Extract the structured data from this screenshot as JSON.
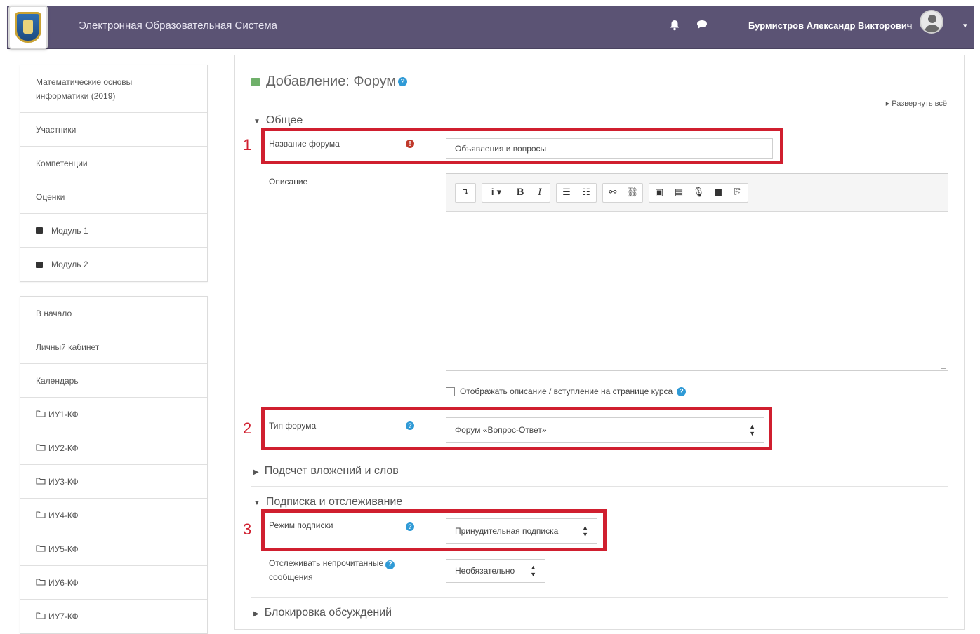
{
  "header": {
    "site_title": "Электронная Образовательная Система",
    "user_name": "Бурмистров Александр Викторович",
    "bell_icon": "bell-icon",
    "chat_icon": "chat-icon",
    "caret": "▾"
  },
  "sidebar": {
    "course_block": [
      {
        "label": "Математические основы информатики (2019)",
        "icon": ""
      },
      {
        "label": "Участники",
        "icon": ""
      },
      {
        "label": "Компетенции",
        "icon": ""
      },
      {
        "label": "Оценки",
        "icon": ""
      },
      {
        "label": "Модуль 1",
        "icon": "module-icon"
      },
      {
        "label": "Модуль 2",
        "icon": "module-icon"
      }
    ],
    "nav_block": [
      {
        "label": "В начало"
      },
      {
        "label": "Личный кабинет"
      },
      {
        "label": "Календарь"
      },
      {
        "label": "ИУ1-КФ"
      },
      {
        "label": "ИУ2-КФ"
      },
      {
        "label": "ИУ3-КФ"
      },
      {
        "label": "ИУ4-КФ"
      },
      {
        "label": "ИУ5-КФ"
      },
      {
        "label": "ИУ6-КФ"
      },
      {
        "label": "ИУ7-КФ"
      }
    ]
  },
  "main": {
    "heading": "Добавление: Форум",
    "expand_all": "Развернуть всё",
    "section_general": "Общее",
    "forum_name_label": "Название форума",
    "forum_name_value": "Объявления и вопросы",
    "description_label": "Описание",
    "show_description_label": "Отображать описание / вступление на странице курса",
    "forum_type_label": "Тип форума",
    "forum_type_value": "Форум «Вопрос-Ответ»",
    "section_attachments": "Подсчет вложений и слов",
    "section_subscription": "Подписка и отслеживание",
    "subscription_mode_label": "Режим подписки",
    "subscription_mode_value": "Принудительная подписка",
    "track_unread_label_1": "Отслеживать непрочитанные",
    "track_unread_label_2": "сообщения",
    "track_unread_value": "Необязательно",
    "section_blocking": "Блокировка обсуждений"
  },
  "annotations": {
    "one": "1",
    "two": "2",
    "three": "3",
    "box_color": "#d01f2f"
  }
}
